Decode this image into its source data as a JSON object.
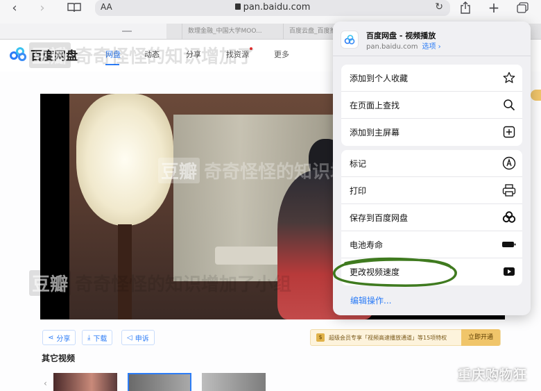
{
  "browser": {
    "text_size_label": "AA",
    "url": "pan.baidu.com",
    "tabs": [
      {
        "label": ""
      },
      {
        "label": "数理金融_中国大学MOO..."
      },
      {
        "label": "百度云盘_百度推..."
      }
    ]
  },
  "site": {
    "logo_text": "百度网盘",
    "nav": [
      "网盘",
      "动态",
      "分享",
      "找资源",
      "更多"
    ],
    "watermark_text": "奇奇怪怪的知识增加了",
    "watermark_text_2": "奇奇怪怪的知识增加了小组",
    "watermark_box": "豆瓣"
  },
  "video_actions": {
    "share": "分享",
    "download": "下载",
    "appeal": "申诉"
  },
  "vip_banner": {
    "badge": "$",
    "text": "超级会员专享「视频高速播放通道」等15项特权",
    "button": "立即开通"
  },
  "other_videos_title": "其它视频",
  "share_sheet": {
    "title": "百度网盘 - 视频播放",
    "domain": "pan.baidu.com",
    "options_label": "选项 ›",
    "group1": [
      {
        "label": "添加到个人收藏",
        "icon": "star-icon"
      },
      {
        "label": "在页面上查找",
        "icon": "search-icon"
      },
      {
        "label": "添加到主屏幕",
        "icon": "add-square-icon"
      }
    ],
    "group2": [
      {
        "label": "标记",
        "icon": "markup-icon"
      },
      {
        "label": "打印",
        "icon": "printer-icon"
      },
      {
        "label": "保存到百度网盘",
        "icon": "baidu-netdisk-icon"
      },
      {
        "label": "电池寿命",
        "icon": "battery-icon"
      },
      {
        "label": "更改视频速度",
        "icon": "play-icon"
      }
    ],
    "edit_actions": "编辑操作..."
  },
  "corner_watermark": "重庆购物狂",
  "colors": {
    "accent": "#2c7cf6",
    "scribble": "#3f7a1f"
  }
}
